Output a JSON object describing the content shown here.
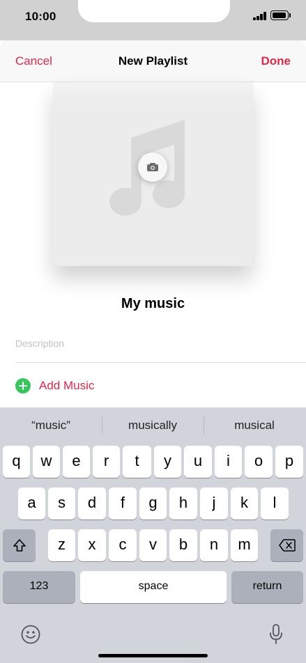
{
  "status_bar": {
    "time": "10:00"
  },
  "nav": {
    "cancel_label": "Cancel",
    "title": "New Playlist",
    "done_label": "Done"
  },
  "playlist": {
    "name": "My music",
    "description_placeholder": "Description",
    "add_music_label": "Add Music"
  },
  "keyboard": {
    "suggestions": [
      "“music”",
      "musically",
      "musical"
    ],
    "row1": [
      "q",
      "w",
      "e",
      "r",
      "t",
      "y",
      "u",
      "i",
      "o",
      "p"
    ],
    "row2": [
      "a",
      "s",
      "d",
      "f",
      "g",
      "h",
      "j",
      "k",
      "l"
    ],
    "row3": [
      "z",
      "x",
      "c",
      "v",
      "b",
      "n",
      "m"
    ],
    "numbers_label": "123",
    "space_label": "space",
    "return_label": "return"
  },
  "colors": {
    "accent": "#e0284a",
    "add_green": "#34c759",
    "keyboard_bg": "#d1d4db"
  }
}
